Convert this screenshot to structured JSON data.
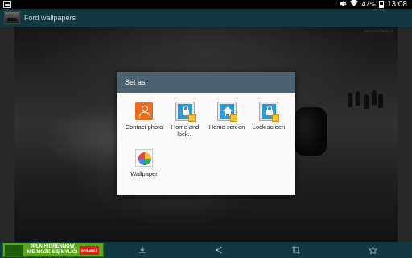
{
  "status_bar": {
    "battery_percent": "42%",
    "time": "13:08",
    "icons": [
      "image-notification-icon",
      "mute-icon",
      "wifi-icon",
      "battery-icon"
    ]
  },
  "action_bar": {
    "title": "Ford wallpapers",
    "icon": "app-car-icon"
  },
  "wallpaper": {
    "watermark": "www.autoTbulk.pl"
  },
  "dialog": {
    "title": "Set as",
    "options": [
      {
        "label": "Contact photo",
        "icon": "contact-icon"
      },
      {
        "label": "Home and lock...",
        "icon": "home-lock-screen-icon"
      },
      {
        "label": "Home screen",
        "icon": "home-screen-icon"
      },
      {
        "label": "Lock screen",
        "icon": "lock-screen-icon"
      },
      {
        "label": "Wallpaper",
        "icon": "photos-pinwheel-icon"
      }
    ]
  },
  "bottom_bar": {
    "ad": {
      "line1": "9PLN HIGRENNOW",
      "line2": "NIE MOŻE SIĘ MYLIĆ!",
      "button": "SPRAWDŹ"
    },
    "actions": [
      "download-icon",
      "share-icon",
      "crop-icon",
      "favorite-star-icon"
    ]
  },
  "colors": {
    "action_bar": "#12393f",
    "dialog_header": "#4c6270",
    "accent_blue": "#2f9bd3",
    "contact_orange": "#ef6c1a"
  }
}
